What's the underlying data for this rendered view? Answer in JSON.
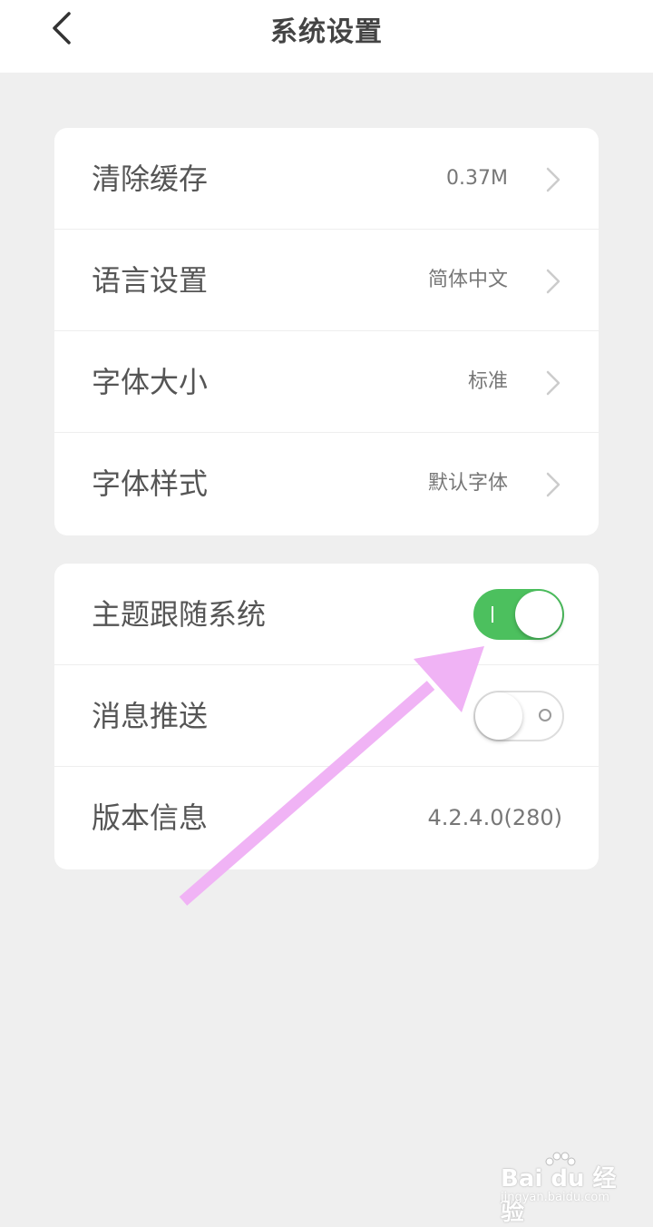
{
  "header": {
    "title": "系统设置",
    "back_icon": "chevron-left-icon"
  },
  "settings_group_1": [
    {
      "label": "清除缓存",
      "value": "0.37M"
    },
    {
      "label": "语言设置",
      "value": "简体中文"
    },
    {
      "label": "字体大小",
      "value": "标准"
    },
    {
      "label": "字体样式",
      "value": "默认字体"
    }
  ],
  "settings_group_2": {
    "theme_follow_system": {
      "label": "主题跟随系统",
      "enabled": true
    },
    "message_push": {
      "label": "消息推送",
      "enabled": false
    },
    "version": {
      "label": "版本信息",
      "value": "4.2.4.0(280)"
    }
  },
  "colors": {
    "toggle_on": "#4cc05e",
    "annotation_arrow": "#f0b3f5",
    "background": "#efefef"
  },
  "watermark": {
    "brand": "Bai du 经验",
    "url": "jingyan.baidu.com"
  }
}
